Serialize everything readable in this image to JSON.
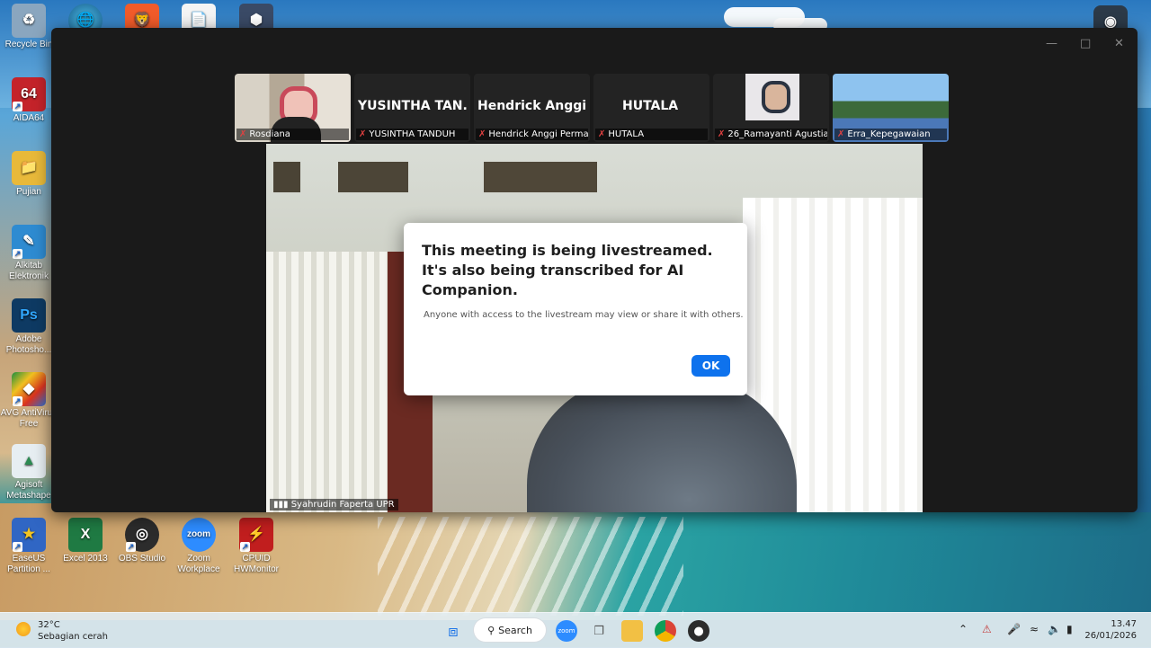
{
  "desktop": {
    "icons": [
      {
        "label": "Recycle Bin",
        "color": "#8aa6bf"
      },
      {
        "label": "AIDA64",
        "glyph": "64",
        "color": "#c4232a"
      },
      {
        "label": "Pujian",
        "color": "#e8b93a"
      },
      {
        "label": "Alkitab Elektronik",
        "color": "#2e8bd1"
      },
      {
        "label": "Adobe Photosho...",
        "glyph": "Ps",
        "color": "#0e3a63"
      },
      {
        "label": "AVG AntiVirus Free",
        "color": "#d9331f"
      },
      {
        "label": "Agisoft Metashape",
        "color": "#e7eef2"
      },
      {
        "label": "EaseUS Partition ...",
        "color": "#3066c4"
      },
      {
        "label": "Excel 2013",
        "glyph": "X",
        "color": "#1f7a43"
      },
      {
        "label": "OBS Studio",
        "color": "#2c2c2c"
      },
      {
        "label": "Zoom Workplace",
        "glyph": "zoom",
        "color": "#2d8cff"
      },
      {
        "label": "CPUID HWMonitor",
        "color": "#c11e1e"
      }
    ]
  },
  "zoom": {
    "thumbnails": [
      {
        "name": "Rosdiana",
        "type": "video"
      },
      {
        "name": "YUSINTHA TANDUH",
        "big": "YUSINTHA TAN...",
        "type": "name"
      },
      {
        "name": "Hendrick Anggi Perma...",
        "big": "Hendrick Anggi...",
        "type": "name"
      },
      {
        "name": "HUTALA",
        "big": "HUTALA",
        "type": "name"
      },
      {
        "name": "26_Ramayanti Agustia...",
        "type": "video"
      },
      {
        "name": "Erra_Kepegawaian",
        "type": "video"
      }
    ],
    "main_video_name": "Syahrudin Faperta UPR",
    "dialog": {
      "title": "This meeting is being livestreamed. It's also being transcribed for AI Companion.",
      "body": "Anyone with access to the livestream may view or share it with others.",
      "ok_label": "OK"
    }
  },
  "taskbar": {
    "weather_temp": "32°C",
    "weather_desc": "Sebagian cerah",
    "search_label": "Search",
    "time": "13.47",
    "date": "26/01/2026"
  }
}
